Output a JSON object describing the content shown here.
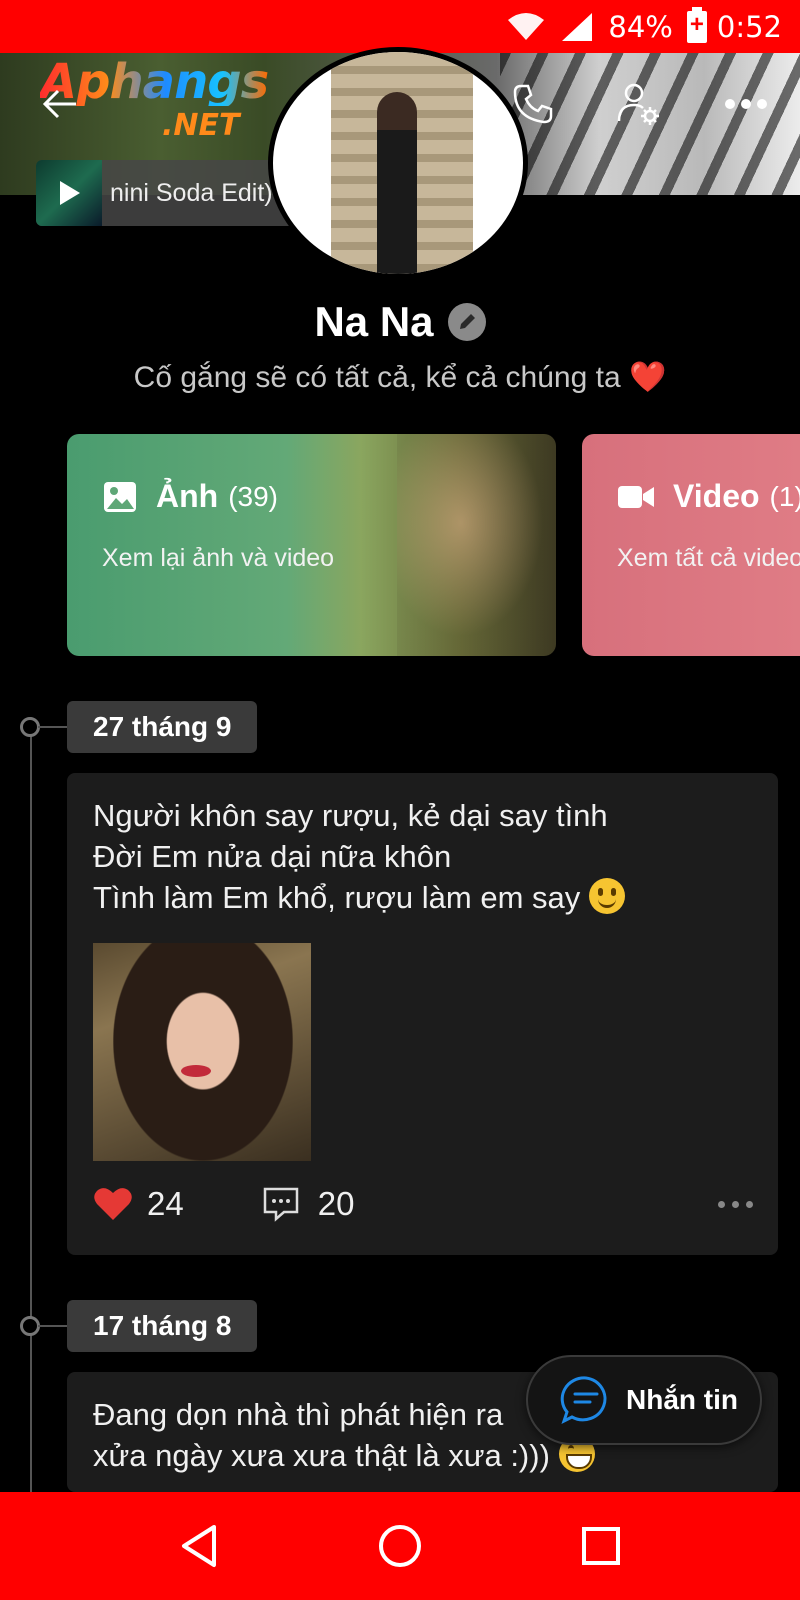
{
  "status_bar": {
    "battery": "84%",
    "time": "0:52"
  },
  "watermark": {
    "brand": "Aphangs",
    "suffix": ".NET"
  },
  "music": {
    "title": "nini Soda Edit)"
  },
  "profile": {
    "name": "Na Na",
    "bio": "Cố gắng sẽ có tất cả, kể cả chúng ta ❤️"
  },
  "media_cards": [
    {
      "label": "Ảnh",
      "count": "(39)",
      "subtitle": "Xem lại ảnh và video",
      "color": "#5fa777"
    },
    {
      "label": "Video",
      "count": "(1)",
      "subtitle": "Xem tất cả video",
      "color": "#dd7883"
    }
  ],
  "posts": [
    {
      "date": "27 tháng 9",
      "lines": [
        "Người khôn say rượu, kẻ dại say tình",
        "Đời Em nửa dại nữa khôn",
        "Tình làm Em khổ, rượu làm em say"
      ],
      "likes": "24",
      "comments": "20"
    },
    {
      "date": "17 tháng 8",
      "lines": [
        "Đang dọn nhà thì phát hiện ra",
        "xửa ngày xưa xưa thật là xưa :)))"
      ]
    }
  ],
  "chat_button": {
    "label": "Nhắn tin"
  },
  "colors": {
    "accent_red": "#ff0000",
    "like_red": "#e53935",
    "chat_blue": "#1e88e5"
  }
}
